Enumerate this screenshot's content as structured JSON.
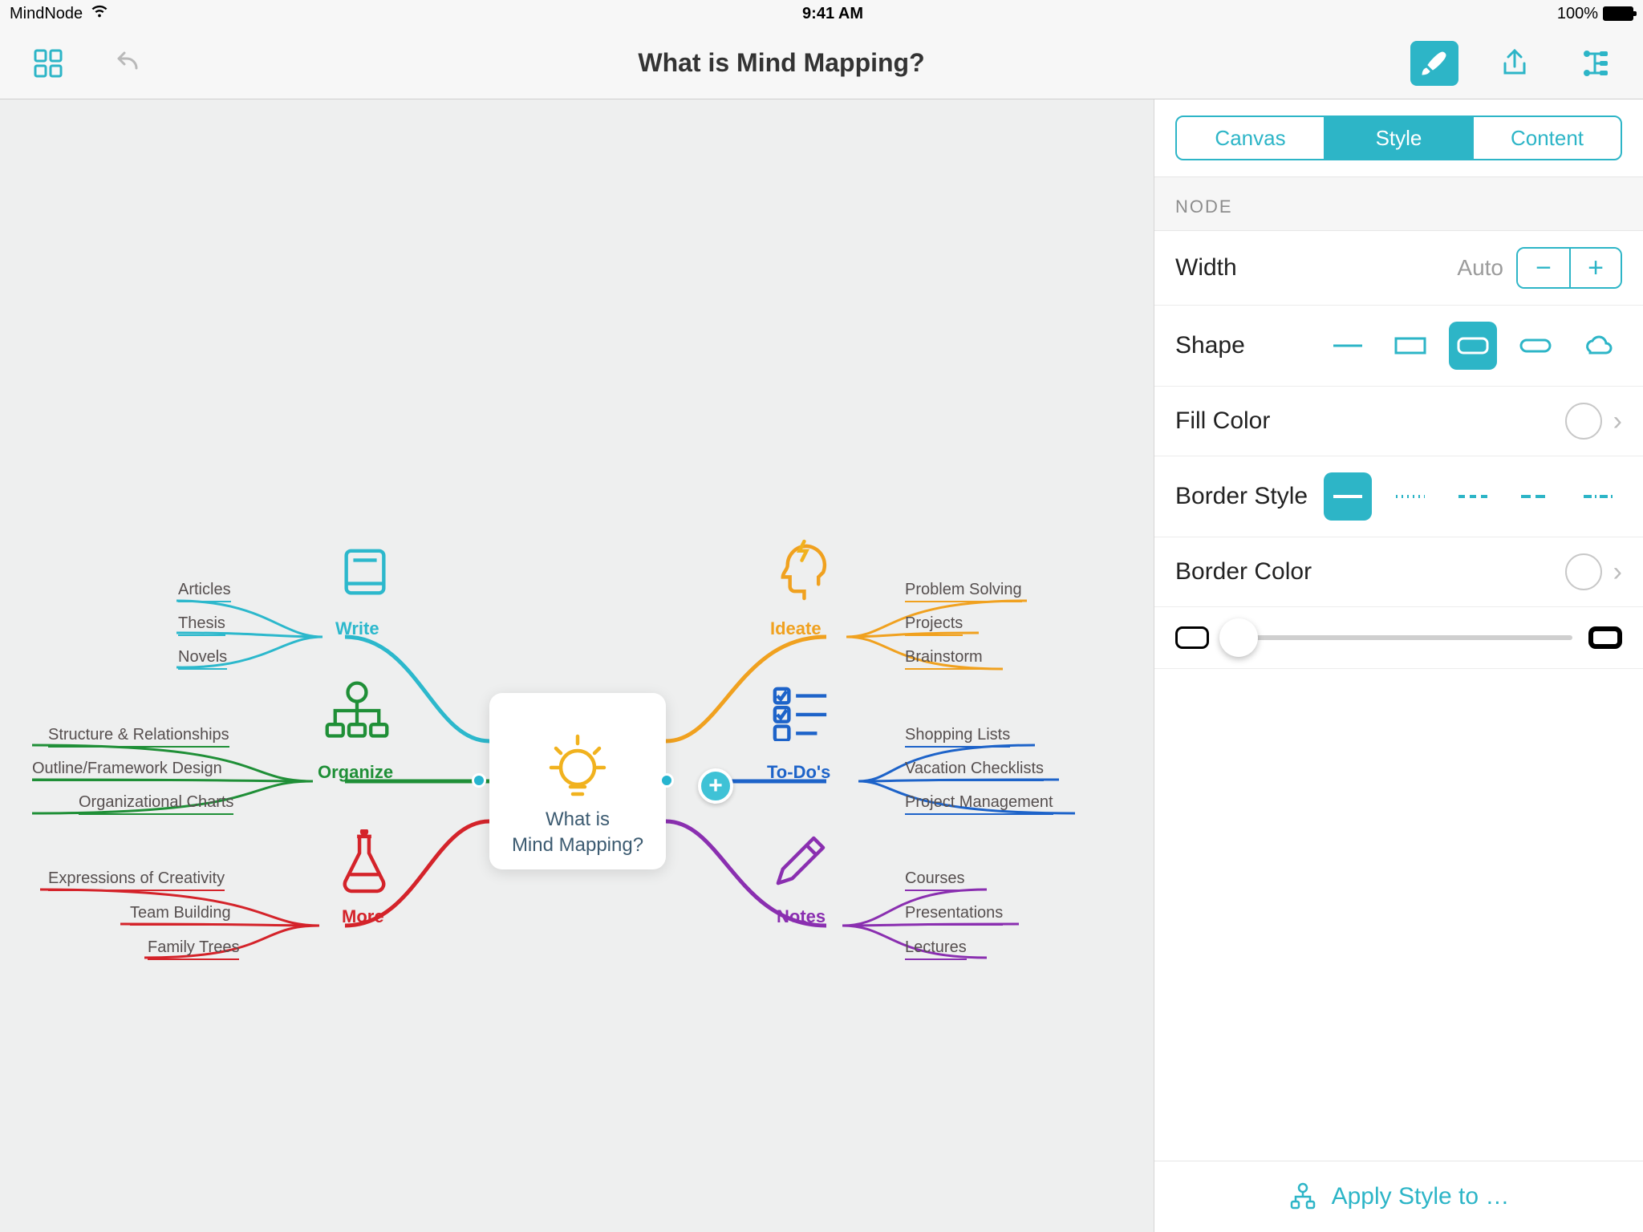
{
  "status": {
    "app_name": "MindNode",
    "time": "9:41 AM",
    "battery_pct": "100%"
  },
  "toolbar": {
    "title": "What is Mind Mapping?"
  },
  "mindmap": {
    "central": {
      "line1": "What is",
      "line2": "Mind Mapping?"
    },
    "branches": {
      "write": {
        "label": "Write",
        "color": "#2cb8cc",
        "leaves": [
          "Articles",
          "Thesis",
          "Novels"
        ]
      },
      "organize": {
        "label": "Organize",
        "color": "#1f8f37",
        "leaves": [
          "Structure & Relationships",
          "Outline/Framework Design",
          "Organizational Charts"
        ]
      },
      "more": {
        "label": "More",
        "color": "#d4232a",
        "leaves": [
          "Expressions of Creativity",
          "Team Building",
          "Family Trees"
        ]
      },
      "ideate": {
        "label": "Ideate",
        "color": "#f0a11f",
        "leaves": [
          "Problem Solving",
          "Projects",
          "Brainstorm"
        ]
      },
      "todos": {
        "label": "To-Do's",
        "color": "#1d63c9",
        "leaves": [
          "Shopping Lists",
          "Vacation Checklists",
          "Project Management"
        ]
      },
      "notes": {
        "label": "Notes",
        "color": "#8a2fb0",
        "leaves": [
          "Courses",
          "Presentations",
          "Lectures"
        ]
      }
    }
  },
  "inspector": {
    "tabs": {
      "canvas": "Canvas",
      "style": "Style",
      "content": "Content",
      "active": "style"
    },
    "section": "NODE",
    "width": {
      "label": "Width",
      "value": "Auto"
    },
    "shape": {
      "label": "Shape"
    },
    "fill": {
      "label": "Fill Color"
    },
    "border_style": {
      "label": "Border Style"
    },
    "border_color": {
      "label": "Border Color"
    },
    "footer": "Apply Style to …"
  }
}
